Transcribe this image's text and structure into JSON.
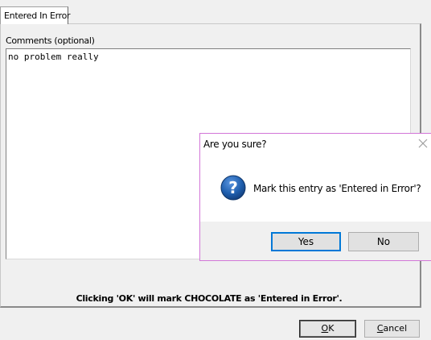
{
  "tab": {
    "label": "Entered In Error"
  },
  "comments": {
    "label": "Comments (optional)",
    "value": "no problem really"
  },
  "footer": {
    "message": "Clicking 'OK' will mark CHOCOLATE as 'Entered in Error'."
  },
  "buttons": {
    "ok": "OK",
    "cancel": "Cancel"
  },
  "dialog": {
    "title": "Are you sure?",
    "icon": "question-icon",
    "message": "Mark this entry as 'Entered in Error'?",
    "yes": "Yes",
    "no": "No"
  },
  "colors": {
    "dialog_border": "#d276d8",
    "default_button_border": "#0078d7",
    "icon_blue": "#1f5fae"
  }
}
